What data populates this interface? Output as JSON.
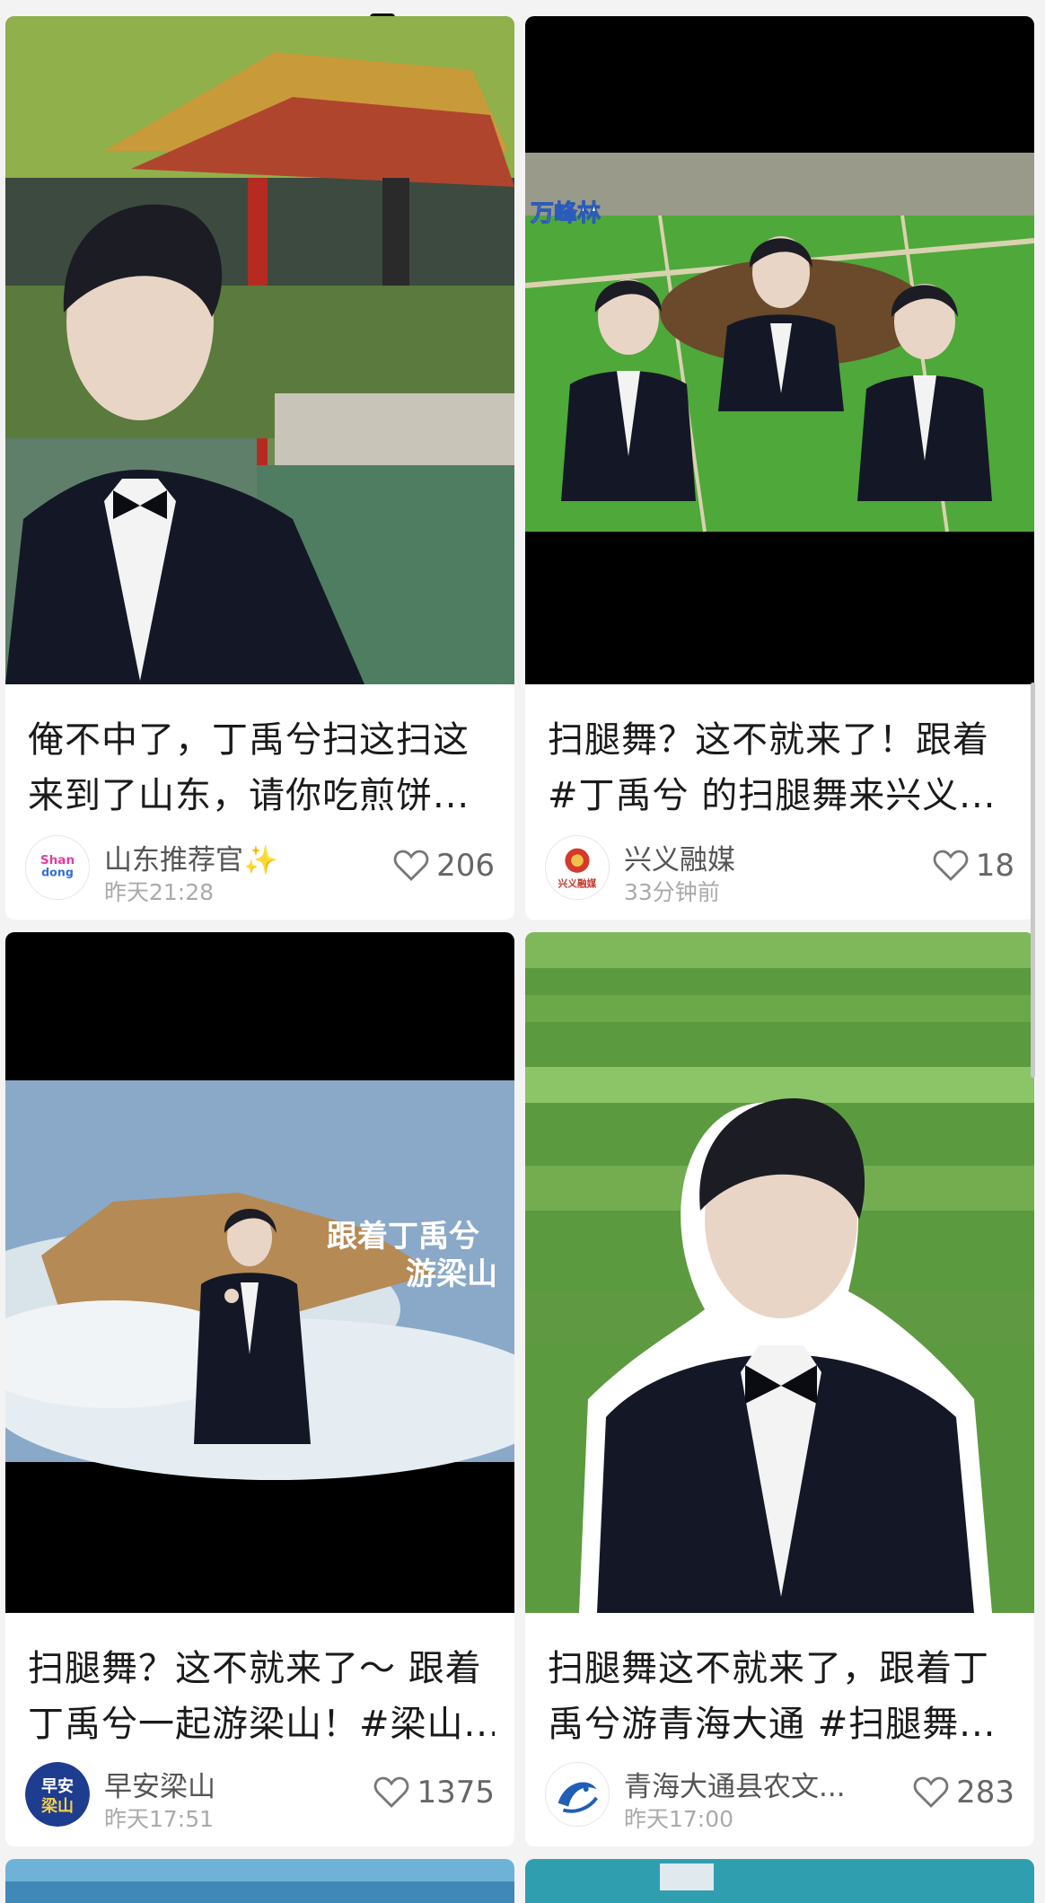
{
  "cards": [
    {
      "title_line1": "俺不中了，丁禹兮扫这扫这",
      "title_line2": "来到了山东，请你吃煎饼...",
      "author": "山东推荐官✨",
      "time": "昨天21:28",
      "likes": "206",
      "avatar_text": "Shandong"
    },
    {
      "title_line1": "扫腿舞？这不就来了！跟着",
      "title_line2": "#丁禹兮 的扫腿舞来兴义...",
      "author": "兴义融媒",
      "time": "33分钟前",
      "likes": "18",
      "thumb_caption": "万峰林",
      "avatar_text": "兴义融媒"
    },
    {
      "title_line1": "扫腿舞？这不就来了～ 跟着",
      "title_line2": "丁禹兮一起游梁山！#梁山...",
      "author": "早安梁山",
      "time": "昨天17:51",
      "likes": "1375",
      "thumb_caption_1": "跟着丁禹兮",
      "thumb_caption_2": "游梁山",
      "avatar_text_1": "早安",
      "avatar_text_2": "梁山"
    },
    {
      "title_line1": "扫腿舞这不就来了，跟着丁",
      "title_line2": "禹兮游青海大通 #扫腿舞...",
      "author": "青海大通县农文...",
      "time": "昨天17:00",
      "likes": "283"
    }
  ],
  "colors": {
    "background": "#f3f3f3",
    "card": "#ffffff",
    "title": "#1a1a1a",
    "muted": "#aaaaaa"
  },
  "icons": [
    "heart-icon"
  ]
}
